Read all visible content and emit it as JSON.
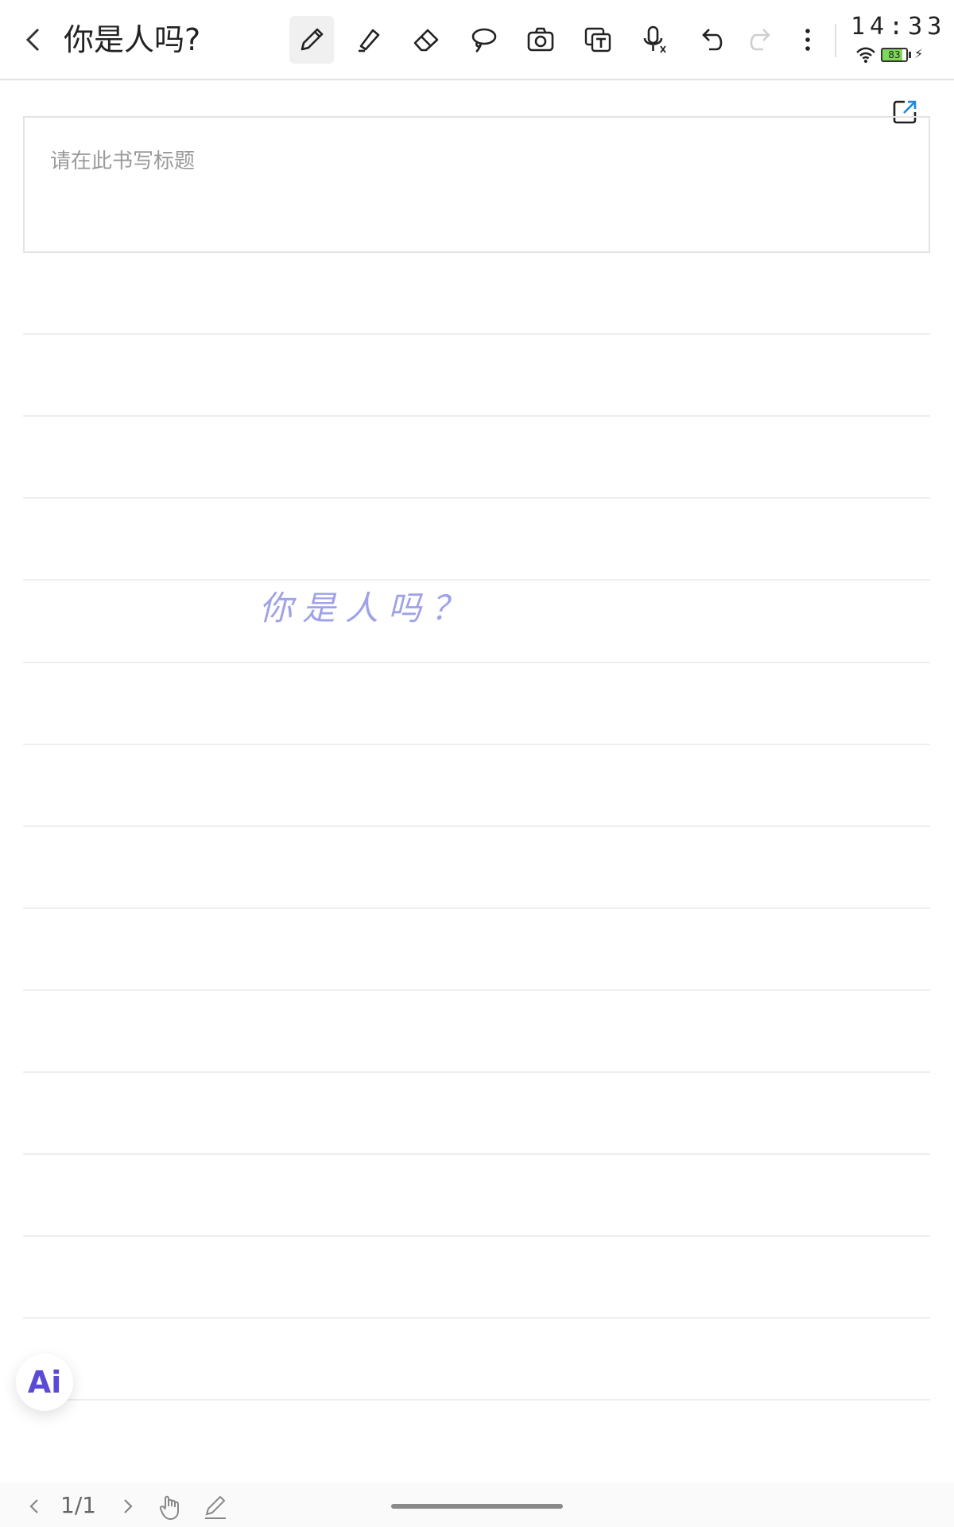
{
  "header": {
    "title": "你是人吗?",
    "tools": [
      {
        "name": "pen-icon",
        "active": true
      },
      {
        "name": "highlighter-icon",
        "active": false
      },
      {
        "name": "eraser-icon",
        "active": false
      },
      {
        "name": "lasso-icon",
        "active": false
      },
      {
        "name": "camera-icon",
        "active": false
      },
      {
        "name": "text-recognition-icon",
        "active": false
      },
      {
        "name": "voice-input-icon",
        "active": false
      },
      {
        "name": "undo-icon",
        "active": false
      },
      {
        "name": "redo-icon",
        "active": false,
        "disabled": true
      },
      {
        "name": "more-icon",
        "active": false
      }
    ]
  },
  "status_bar": {
    "time": "14:33",
    "battery_level": "83",
    "wifi": "wifi-icon"
  },
  "note": {
    "title_placeholder": "请在此书写标题",
    "handwritten_text": "你是人吗？"
  },
  "ai_button": {
    "label": "Ai"
  },
  "footer": {
    "page_indicator": "1/1"
  },
  "colors": {
    "handwriting": "#9fa2e8",
    "accent": "#5b4ad6",
    "export_icon_accent": "#1e88e5"
  }
}
